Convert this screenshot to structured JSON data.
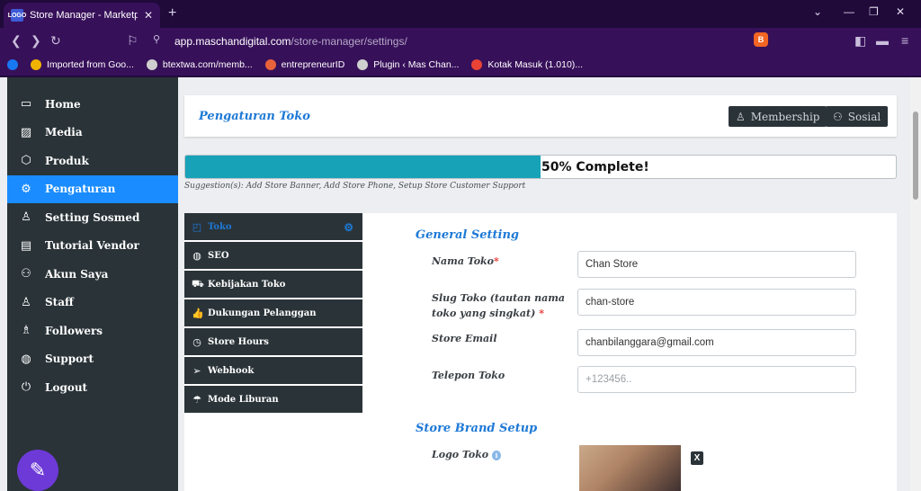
{
  "browser": {
    "tab_title": "Store Manager - Marketplace M",
    "tab_favicon": "LOGO",
    "new_tab_icon": "+",
    "url_domain": "app.maschandigital.com",
    "url_path": "/store-manager/settings/",
    "bookmarks": [
      {
        "label": "",
        "icon": "facebook-icon",
        "color": "#1877f2"
      },
      {
        "label": "Imported from Goo...",
        "icon": "folder-icon",
        "color": "#f0b400"
      },
      {
        "label": "btextwa.com/memb...",
        "icon": "globe-icon",
        "color": "#cfcfcf"
      },
      {
        "label": "entrepreneurID",
        "icon": "site-icon",
        "color": "#e8623a"
      },
      {
        "label": "Plugin ‹ Mas Chan...",
        "icon": "wordpress-icon",
        "color": "#cfcfcf"
      },
      {
        "label": "Kotak Masuk (1.010)...",
        "icon": "gmail-icon",
        "color": "#ea4335"
      }
    ]
  },
  "sidebar": {
    "items": [
      {
        "label": "Home",
        "icon": "monitor-icon",
        "glyph": "▭"
      },
      {
        "label": "Media",
        "icon": "image-icon",
        "glyph": "▨"
      },
      {
        "label": "Produk",
        "icon": "cube-icon",
        "glyph": "⬡"
      },
      {
        "label": "Pengaturan",
        "icon": "cogs-icon",
        "glyph": "⚙"
      },
      {
        "label": "Setting Sosmed",
        "icon": "user-icon",
        "glyph": "♙"
      },
      {
        "label": "Tutorial Vendor",
        "icon": "book-icon",
        "glyph": "▤"
      },
      {
        "label": "Akun Saya",
        "icon": "users-icon",
        "glyph": "⚇"
      },
      {
        "label": "Staff",
        "icon": "user-icon",
        "glyph": "♙"
      },
      {
        "label": "Followers",
        "icon": "followers-icon",
        "glyph": "♗"
      },
      {
        "label": "Support",
        "icon": "globe-icon",
        "glyph": "◍"
      },
      {
        "label": "Logout",
        "icon": "power-icon",
        "glyph": "⏻"
      }
    ],
    "active_index": 3
  },
  "header": {
    "title": "Pengaturan Toko",
    "membership_label": "Membership",
    "sosial_label": "Sosial"
  },
  "progress": {
    "percent": 50,
    "text": "50% Complete!",
    "suggestion": "Suggestion(s): Add Store Banner, Add Store Phone, Setup Store Customer Support"
  },
  "settings_tabs": [
    {
      "label": "Toko",
      "icon": "shopping-bag-icon",
      "glyph": "◰"
    },
    {
      "label": "SEO",
      "icon": "globe-icon",
      "glyph": "◍"
    },
    {
      "label": "Kebijakan Toko",
      "icon": "truck-icon",
      "glyph": "⛟"
    },
    {
      "label": "Dukungan Pelanggan",
      "icon": "thumbs-up-icon",
      "glyph": "👍"
    },
    {
      "label": "Store Hours",
      "icon": "clock-icon",
      "glyph": "◷"
    },
    {
      "label": "Webhook",
      "icon": "send-icon",
      "glyph": "➢"
    },
    {
      "label": "Mode Liburan",
      "icon": "vacation-icon",
      "glyph": "☂"
    }
  ],
  "general": {
    "section_title": "General Setting",
    "store_name_label": "Nama Toko",
    "store_name_value": "Chan Store",
    "slug_label": "Slug Toko (tautan nama toko yang singkat)",
    "slug_value": "chan-store",
    "email_label": "Store Email",
    "email_value": "chanbilanggara@gmail.com",
    "phone_label": "Telepon Toko",
    "phone_placeholder": "+123456.."
  },
  "brand": {
    "section_title": "Store Brand Setup",
    "logo_label": "Logo Toko",
    "logo_info": "i",
    "remove_label": "X"
  },
  "colors": {
    "accent": "#1a8cff",
    "progress": "#17a2b8",
    "sidebar": "#2a3338",
    "required": "#e53935"
  }
}
